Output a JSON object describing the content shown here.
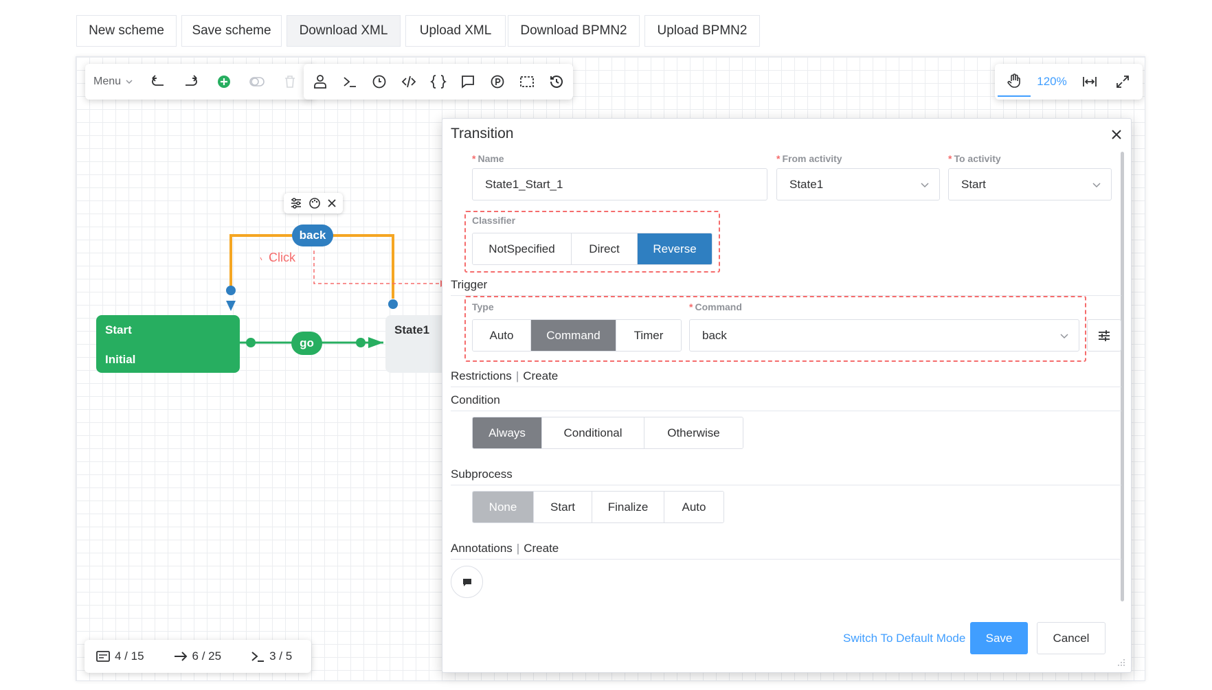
{
  "top_buttons": [
    "New scheme",
    "Save scheme",
    "Download XML",
    "Upload XML",
    "Download BPMN2",
    "Upload BPMN2"
  ],
  "toolbar_left": {
    "menu_label": "Menu"
  },
  "zoom": {
    "level": "120%"
  },
  "diagram": {
    "start_node": {
      "title": "Start",
      "subtitle": "Initial"
    },
    "state1_node": {
      "title": "State1"
    },
    "transition_go": "go",
    "transition_back": "back",
    "hint": "Click"
  },
  "colors": {
    "green": "#27ae60",
    "orange": "#f5a623",
    "blue": "#2f7fc1",
    "accent": "#409eff"
  },
  "dialog": {
    "title": "Transition",
    "name": {
      "label": "Name",
      "value": "State1_Start_1"
    },
    "from_activity": {
      "label": "From activity",
      "value": "State1"
    },
    "to_activity": {
      "label": "To activity",
      "value": "Start"
    },
    "classifier": {
      "label": "Classifier",
      "options": [
        "NotSpecified",
        "Direct",
        "Reverse"
      ],
      "selected": "Reverse"
    },
    "trigger": {
      "title": "Trigger",
      "type_label": "Type",
      "types": [
        "Auto",
        "Command",
        "Timer"
      ],
      "selected": "Command",
      "command_label": "Command",
      "command_value": "back"
    },
    "restrictions": {
      "title": "Restrictions",
      "action": "Create"
    },
    "condition": {
      "title": "Condition",
      "options": [
        "Always",
        "Conditional",
        "Otherwise"
      ],
      "selected": "Always"
    },
    "subprocess": {
      "title": "Subprocess",
      "options": [
        "None",
        "Start",
        "Finalize",
        "Auto"
      ],
      "selected": "None"
    },
    "annotations": {
      "title": "Annotations",
      "action": "Create"
    },
    "switch_mode": "Switch To Default Mode",
    "save": "Save",
    "cancel": "Cancel"
  },
  "status": {
    "activities": "4 / 15",
    "transitions": "6 / 25",
    "commands": "3 / 5"
  }
}
